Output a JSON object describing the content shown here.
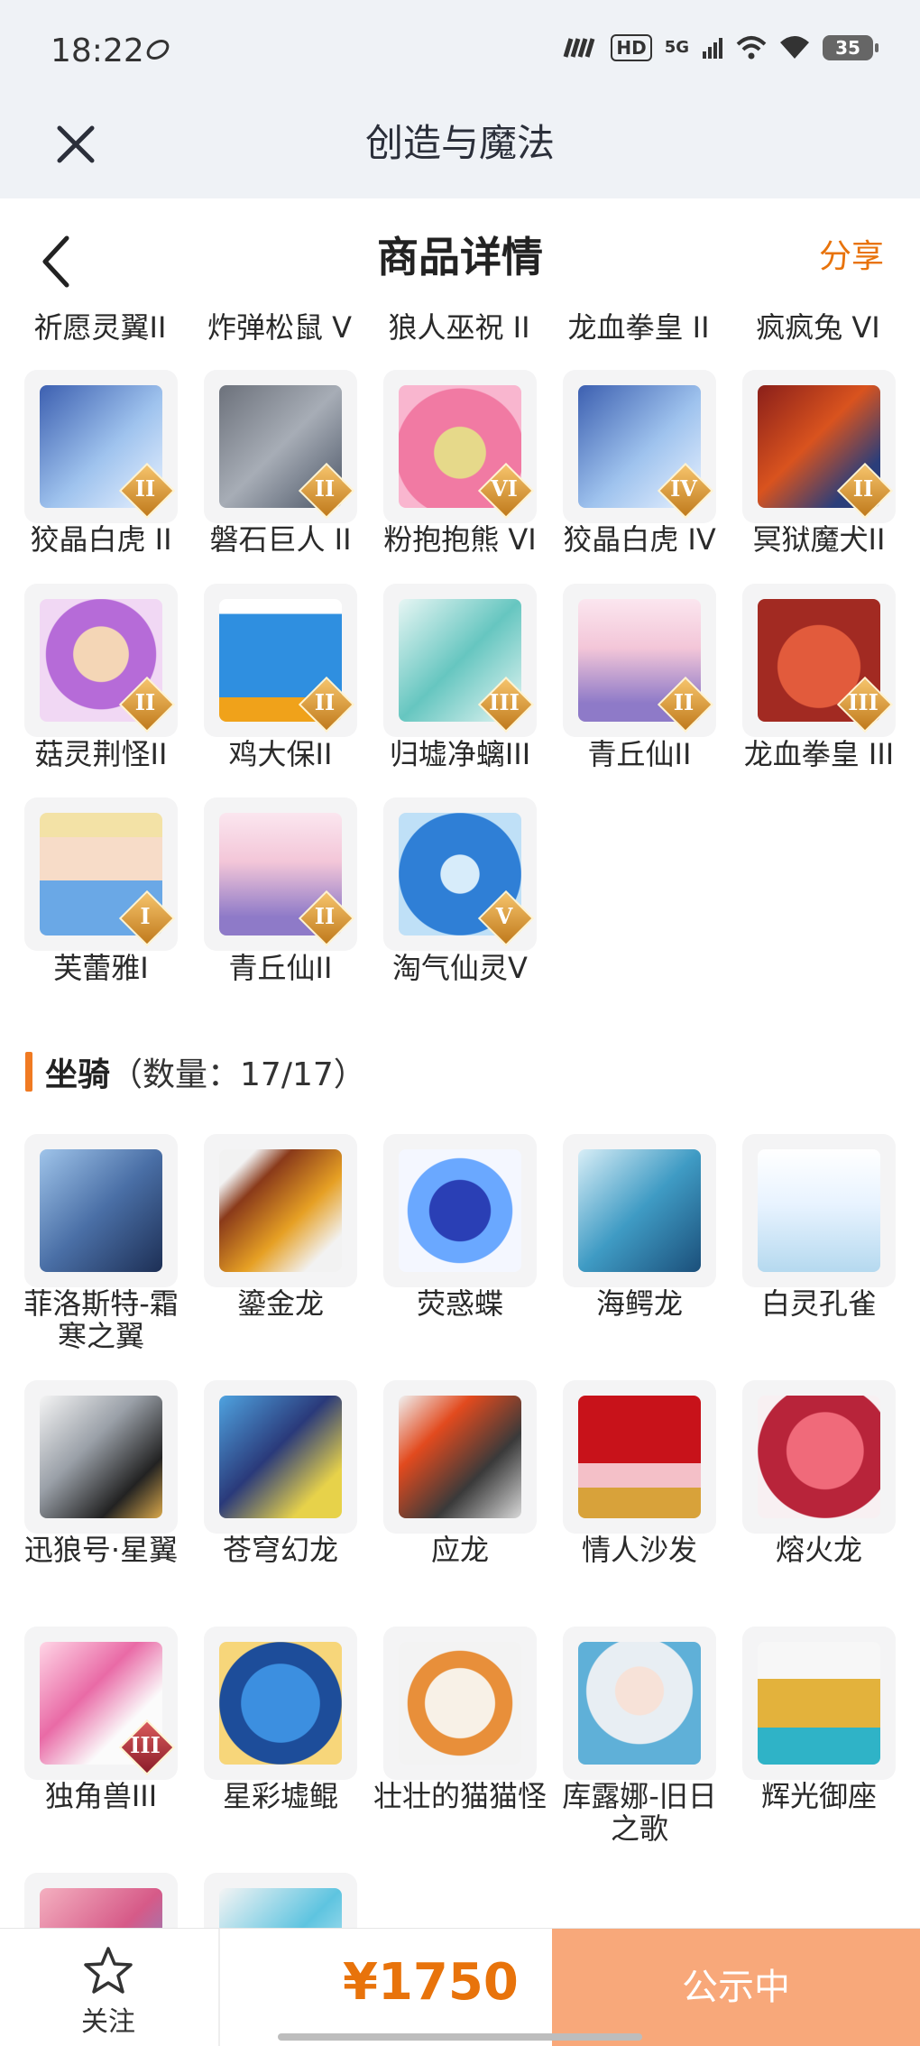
{
  "status_bar": {
    "time": "18:22",
    "network_hd": "HD",
    "network_5g": "5G",
    "battery": "35"
  },
  "app_header": {
    "title": "创造与魔法"
  },
  "page_header": {
    "title": "商品详情",
    "share": "分享"
  },
  "pets_partial_labels": [
    "祈愿灵翼II",
    "炸弹松鼠 V",
    "狼人巫祝 II",
    "龙血拳皇 II",
    "疯疯兔 VI"
  ],
  "pets": [
    {
      "label": "狡晶白虎 II",
      "badge": "II"
    },
    {
      "label": "磐石巨人 II",
      "badge": "II"
    },
    {
      "label": "粉抱抱熊 VI",
      "badge": "VI"
    },
    {
      "label": "狡晶白虎 IV",
      "badge": "IV"
    },
    {
      "label": "冥狱魔犬II",
      "badge": "II"
    },
    {
      "label": "菇灵荆怪II",
      "badge": "II"
    },
    {
      "label": "鸡大保II",
      "badge": "II"
    },
    {
      "label": "归墟净螭III",
      "badge": "III"
    },
    {
      "label": "青丘仙II",
      "badge": "II"
    },
    {
      "label": "龙血拳皇 III",
      "badge": "III"
    },
    {
      "label": "芙蕾雅I",
      "badge": "I"
    },
    {
      "label": "青丘仙II",
      "badge": "II"
    },
    {
      "label": "淘气仙灵V",
      "badge": "V"
    }
  ],
  "mounts_section": {
    "title": "坐骑",
    "count": "（数量：17/17）"
  },
  "mounts": [
    {
      "label": "菲洛斯特-霜寒之翼"
    },
    {
      "label": "鎏金龙"
    },
    {
      "label": "荧惑蝶"
    },
    {
      "label": "海鳄龙"
    },
    {
      "label": "白灵孔雀"
    },
    {
      "label": "迅狼号·星翼"
    },
    {
      "label": "苍穹幻龙"
    },
    {
      "label": "应龙"
    },
    {
      "label": "情人沙发"
    },
    {
      "label": "熔火龙"
    },
    {
      "label": "独角兽III",
      "badge": "III"
    },
    {
      "label": "星彩墟鲲"
    },
    {
      "label": "壮壮的猫猫怪"
    },
    {
      "label": "库露娜-旧日之歌"
    },
    {
      "label": "辉光御座"
    }
  ],
  "bottom_bar": {
    "follow": "关注",
    "price": "¥1750",
    "cta": "公示中"
  },
  "colors": {
    "accent": "#e8730b",
    "cta_bg": "#f8a87a",
    "section_bar": "#f07a22"
  },
  "icons": [
    "close-icon",
    "back-arrow-icon",
    "star-icon",
    "signal-icon",
    "wifi-icon",
    "battery-icon"
  ]
}
